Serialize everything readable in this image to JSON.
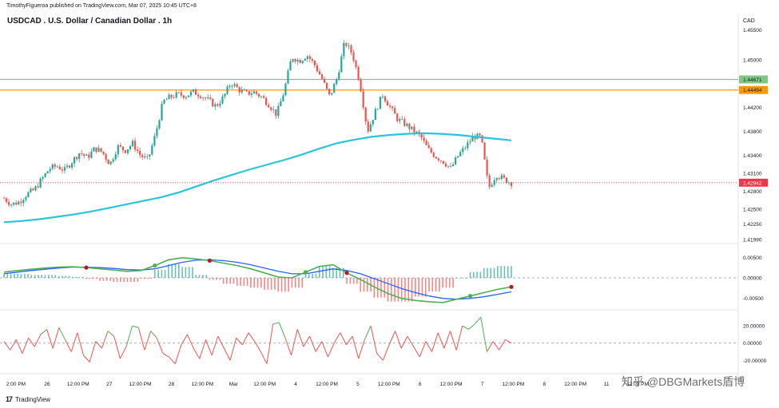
{
  "header": {
    "published_line": "TimothyFigueroa published on TradingView.com, Mar 07, 2025 10:45 UTC+8",
    "symbol_line": "USDCAD . U.S. Dollar / Canadian Dollar . 1h",
    "currency": "CAD"
  },
  "footer": {
    "logo_text": "TradingView",
    "logo_mark": "17",
    "watermark": "知乎 @DBGMarkets盾博"
  },
  "colors": {
    "up": "#26a69a",
    "down": "#ef5350",
    "ma": "#26c6da",
    "green_line": "#81c784",
    "orange_line": "#ff9800",
    "price_tag": "#f23645"
  },
  "chart_data": [
    {
      "type": "candlestick",
      "title": "USDCAD . U.S. Dollar / Canadian Dollar . 1h",
      "ylim": [
        1.4199,
        1.456
      ],
      "yticks": [
        "1.45500",
        "1.45000",
        "1.44200",
        "1.43800",
        "1.43400",
        "1.43100",
        "1.42800",
        "1.42500",
        "1.42250",
        "1.41990"
      ],
      "x_ticks": [
        "2:00 PM",
        "26",
        "12:00 PM",
        "27",
        "12:00 PM",
        "28",
        "12:00 PM",
        "Mar",
        "12:00 PM",
        "4",
        "12:00 PM",
        "5",
        "12:00 PM",
        "6",
        "12:00 PM",
        "7",
        "12:00 PM",
        "8",
        "12:00 PM",
        "11",
        "12:00 PM"
      ],
      "horizontal_lines": [
        {
          "value": 1.44671,
          "label": "1.44671",
          "color": "#81c784"
        },
        {
          "value": 1.44494,
          "label": "1.44494",
          "color": "#ff9800"
        }
      ],
      "current_price": {
        "value": 1.42942,
        "label": "1.42942"
      },
      "close_path": [
        1.4268,
        1.4258,
        1.4262,
        1.4275,
        1.4282,
        1.43,
        1.4318,
        1.4322,
        1.4315,
        1.433,
        1.4345,
        1.4336,
        1.4352,
        1.4345,
        1.4325,
        1.4355,
        1.4348,
        1.436,
        1.434,
        1.4332,
        1.4375,
        1.443,
        1.4438,
        1.4442,
        1.444,
        1.4446,
        1.4441,
        1.4432,
        1.4422,
        1.4438,
        1.4462,
        1.445,
        1.4443,
        1.4446,
        1.4438,
        1.4425,
        1.4408,
        1.4448,
        1.4505,
        1.4498,
        1.4508,
        1.4492,
        1.4468,
        1.4438,
        1.447,
        1.453,
        1.451,
        1.4462,
        1.438,
        1.4412,
        1.4442,
        1.442,
        1.44,
        1.4392,
        1.4382,
        1.4372,
        1.435,
        1.4338,
        1.433,
        1.4318,
        1.434,
        1.4355,
        1.4372,
        1.437,
        1.4285,
        1.4308,
        1.43,
        1.4294
      ],
      "moving_average": [
        1.4228,
        1.423,
        1.4233,
        1.4237,
        1.4241,
        1.4246,
        1.4252,
        1.4258,
        1.4264,
        1.427,
        1.4278,
        1.4288,
        1.4298,
        1.4307,
        1.4316,
        1.4324,
        1.4332,
        1.4341,
        1.4351,
        1.436,
        1.4366,
        1.4371,
        1.4374,
        1.4376,
        1.4377,
        1.4376,
        1.4374,
        1.4371,
        1.4368,
        1.4365
      ],
      "moving_average_color": "#26c6da"
    },
    {
      "type": "line",
      "yticks": [
        "0.00500",
        "0.00000",
        "-0.00500"
      ],
      "ylim": [
        -0.0068,
        0.007
      ],
      "series": [
        {
          "values": [
            0.0014,
            0.0018,
            0.0021,
            0.0024,
            0.0026,
            0.0027,
            0.0025,
            0.0022,
            0.0019,
            0.0016,
            0.0018,
            0.003,
            0.0044,
            0.0049,
            0.0046,
            0.0042,
            0.0036,
            0.003,
            0.0022,
            0.0012,
            0.0002,
            0.0,
            0.0014,
            0.0028,
            0.0032,
            0.0012,
            -0.0004,
            -0.0022,
            -0.0038,
            -0.005,
            -0.0055,
            -0.0058,
            -0.006,
            -0.0052,
            -0.0044,
            -0.0036,
            -0.0028,
            -0.0022
          ],
          "color": "#4caf50"
        },
        {
          "values": [
            0.001,
            0.0014,
            0.0018,
            0.0021,
            0.0024,
            0.0026,
            0.0026,
            0.0025,
            0.0023,
            0.002,
            0.0019,
            0.0022,
            0.003,
            0.0038,
            0.0043,
            0.0044,
            0.0042,
            0.0038,
            0.0032,
            0.0024,
            0.0016,
            0.001,
            0.001,
            0.0016,
            0.0022,
            0.0018,
            0.001,
            -0.0002,
            -0.0014,
            -0.0026,
            -0.0036,
            -0.0044,
            -0.005,
            -0.0052,
            -0.005,
            -0.0046,
            -0.004,
            -0.0034
          ],
          "color": "#2962ff"
        }
      ]
    },
    {
      "type": "line",
      "yticks": [
        "20.00000",
        "0.00000",
        "-20.00000"
      ],
      "ylim": [
        -28,
        34
      ],
      "series": [
        {
          "values": [
            2,
            -8,
            4,
            -12,
            6,
            -4,
            10,
            16,
            -6,
            18,
            4,
            -10,
            12,
            -14,
            -22,
            2,
            -6,
            14,
            8,
            -18,
            -4,
            20,
            18,
            -8,
            14,
            6,
            -12,
            -16,
            -24,
            -2,
            10,
            -6,
            -18,
            4,
            -14,
            8,
            -6,
            -20,
            6,
            -2,
            12,
            2,
            -10,
            -24,
            22,
            24,
            6,
            -14,
            16,
            -4,
            8,
            -10,
            2,
            -16,
            0,
            12,
            -2,
            8,
            -18,
            4,
            20,
            -12,
            -20,
            -2,
            14,
            -6,
            8,
            -4,
            -16,
            2,
            -10,
            12,
            -6,
            14,
            -8,
            20,
            16,
            22,
            30,
            -10,
            2,
            -8,
            4,
            0
          ],
          "color": "#ef5350"
        }
      ]
    }
  ]
}
